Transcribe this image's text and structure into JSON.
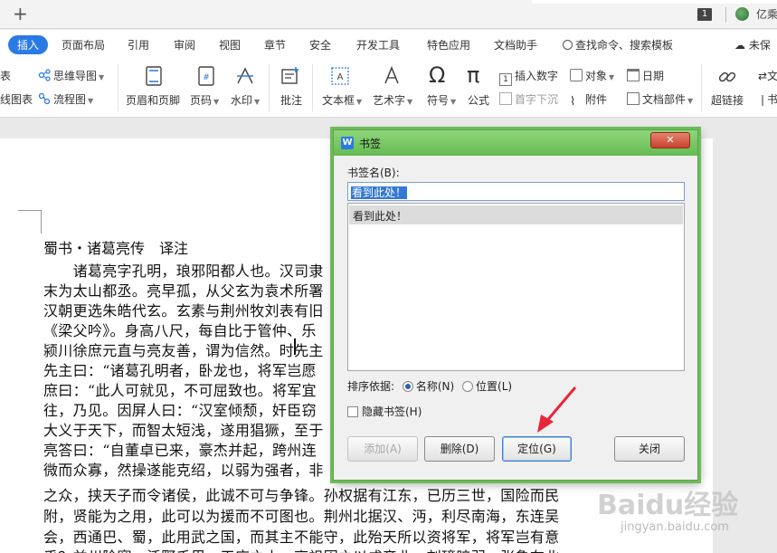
{
  "topbar": {
    "new_tab": "+",
    "badge": "1",
    "user": "亿乘"
  },
  "menu": {
    "tabs": [
      "插入",
      "页面布局",
      "引用",
      "审阅",
      "视图",
      "章节",
      "安全",
      "开发工具",
      "特色应用",
      "文档助手"
    ],
    "search": "查找命令、搜索模板",
    "unsync": "未保"
  },
  "ribbon": {
    "left_cut_1": "表",
    "left_cut_2": "线图表",
    "mindmap": "思维导图",
    "flowchart": "流程图",
    "header_footer": "页眉和页脚",
    "page_number": "页码",
    "watermark": "水印",
    "annotate": "批注",
    "textbox": "文本框",
    "wordart": "艺术字",
    "symbol": "符号",
    "formula": "公式",
    "insert_number": "插入数字",
    "object": "对象",
    "date": "日期",
    "dropcap": "首字下沉",
    "attachment": "附件",
    "doc_parts": "文档部件",
    "hyperlink": "超链接",
    "right_cut_1": "文",
    "right_cut_2": "书"
  },
  "document": {
    "title": "蜀书・诸葛亮传　译注",
    "lines": [
      "　　诸葛亮字孔明，琅邪阳都人也。汉司隶",
      "末为太山都丞。亮早孤，从父玄为袁术所署",
      "汉朝更选朱皓代玄。玄素与荆州牧刘表有旧",
      "《梁父吟》。身高八尺，每自比于管仲、乐",
      "颍川徐庶元直与亮友善，谓为信然。时先主",
      "先主曰：“诸葛孔明者，卧龙也，将军岂愿",
      "庶曰：“此人可就见，不可屈致也。将军宜",
      "往，乃见。因屏人曰：“汉室倾颓，奸臣窃",
      "大义于天下，而智太短浅，遂用猖獗，至于",
      "亮答曰：“自董卓已来，豪杰并起，跨州连",
      "微而众寡，然操遂能克绍，以弱为强者，非",
      "之众，挟天子而令诸侯，此诚不可与争锋。孙权据有江东，已历三世，国险而民",
      "附，贤能为之用，此可以为援而不可图也。荆州北据汉、沔，利尽南海，东连吴",
      "会，西通巴、蜀，此用武之国，而其主不能守，此殆天所以资将军，将军岂有意",
      "乎？益州险塞，沃野千里，天府之土，高祖因之以成帝业。刘璋暗弱，张鲁在北"
    ]
  },
  "dialog": {
    "title": "书签",
    "close": "✕",
    "name_label": "书签名(B):",
    "name_value": "看到此处！",
    "list": [
      "看到此处！"
    ],
    "sort_label": "排序依据:",
    "sort_name": "名称(N)",
    "sort_position": "位置(L)",
    "hide_label": "隐藏书签(H)",
    "add": "添加(A)",
    "delete": "删除(D)",
    "goto": "定位(G)",
    "close_btn": "关闭"
  },
  "watermark": {
    "brand": "Baidu经验",
    "url": "jingyan.baidu.com"
  },
  "colors": {
    "accent": "#2a7ae4",
    "dialog_frame": "#6dbb5a",
    "arrow": "#e8263a"
  }
}
